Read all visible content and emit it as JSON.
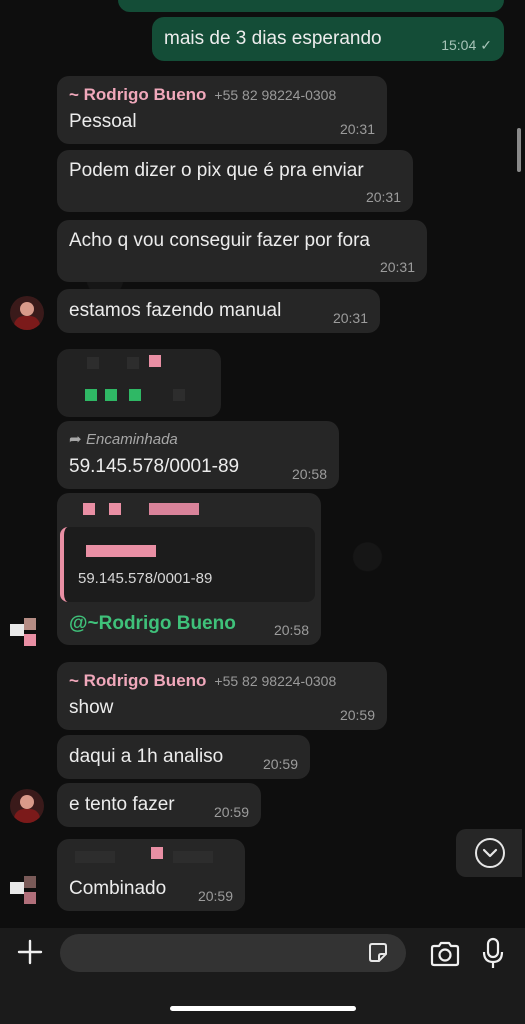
{
  "messages": {
    "m1": {
      "text": "mais de 3 dias esperando",
      "time": "15:04"
    },
    "m2": {
      "sender": "~ Rodrigo Bueno",
      "phone": "+55 82 98224-0308",
      "text": "Pessoal",
      "time": "20:31"
    },
    "m3": {
      "text": "Podem dizer o pix que é pra enviar",
      "time": "20:31"
    },
    "m4": {
      "text": "Acho q vou conseguir fazer por fora",
      "time": "20:31"
    },
    "m5": {
      "text": "estamos fazendo manual",
      "time": "20:31"
    },
    "m6": {
      "forwarded_label": "Encaminhada",
      "text": "59.145.578/0001-89",
      "time": "20:58"
    },
    "m7": {
      "quoted_text": "59.145.578/0001-89",
      "text": "@~Rodrigo Bueno",
      "time": "20:58"
    },
    "m8": {
      "sender": "~ Rodrigo Bueno",
      "phone": "+55 82 98224-0308",
      "text": "show",
      "time": "20:59"
    },
    "m9": {
      "text": "daqui a 1h analiso",
      "time": "20:59"
    },
    "m10": {
      "text": "e tento fazer",
      "time": "20:59"
    },
    "m11": {
      "text": "Combinado",
      "time": "20:59"
    }
  },
  "icons": {
    "check": "check-icon",
    "forward": "forward-arrow-icon",
    "scroll_down": "chevron-down-icon",
    "plus": "plus-icon",
    "sticker": "sticker-icon",
    "camera": "camera-icon",
    "mic": "microphone-icon"
  },
  "colors": {
    "outgoing_bubble": "#144d37",
    "incoming_bubble": "#262626",
    "sender_name": "#f0a8bb",
    "mention": "#3fc17a"
  }
}
